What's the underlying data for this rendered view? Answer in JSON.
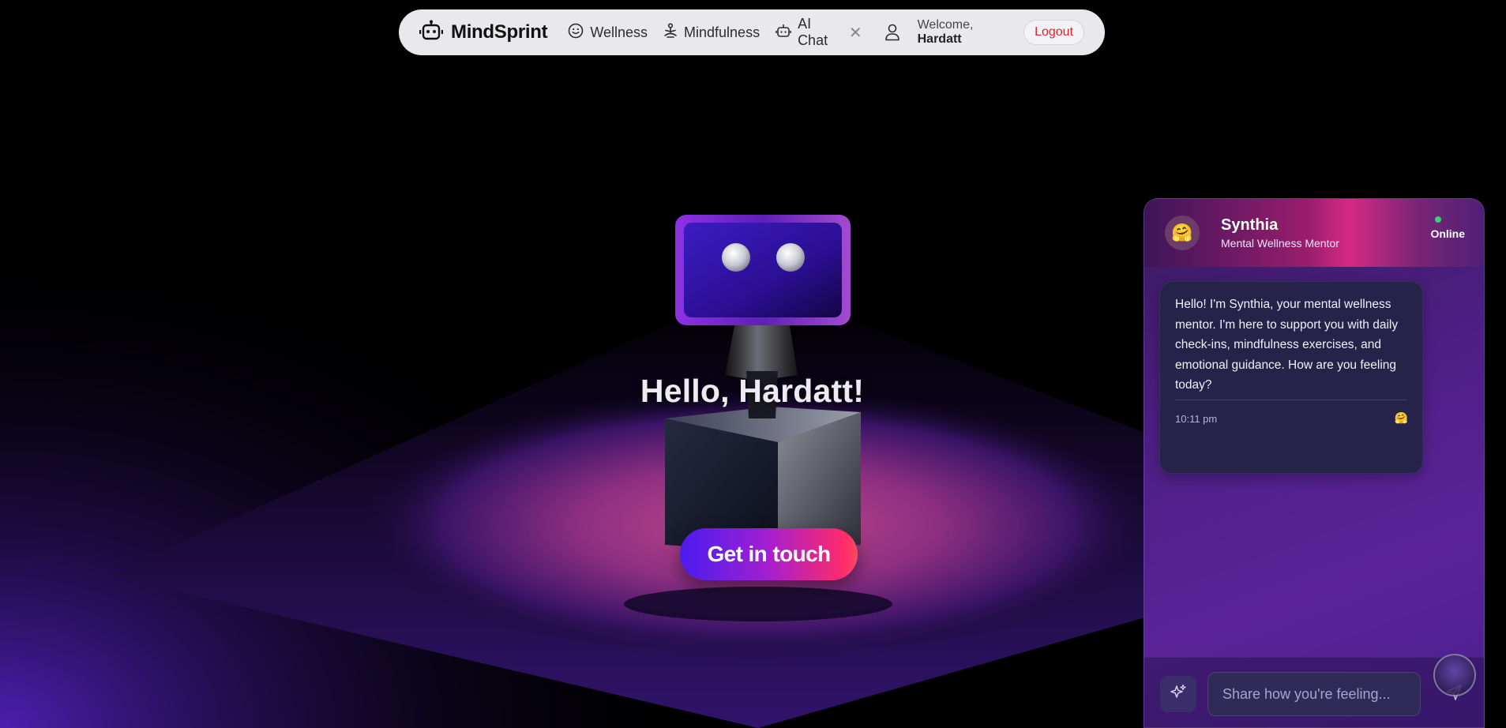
{
  "nav": {
    "brand": "MindSprint",
    "links": [
      {
        "label": "Wellness",
        "icon": "smile-icon"
      },
      {
        "label": "Mindfulness",
        "icon": "meditation-icon"
      },
      {
        "label": "AI Chat",
        "icon": "robot-icon"
      }
    ],
    "welcome_prefix": "Welcome,",
    "username": "Hardatt",
    "logout_label": "Logout"
  },
  "hero": {
    "greeting": "Hello, Hardatt!",
    "cta_label": "Get in touch"
  },
  "chat": {
    "agent_name": "Synthia",
    "agent_role": "Mental Wellness Mentor",
    "agent_avatar": "🤗",
    "status": "Online",
    "message": {
      "text": "Hello! I'm Synthia, your mental wellness mentor. I'm here to support you with daily check-ins, mindfulness exercises, and emotional guidance. How are you feeling today?",
      "time": "10:11 pm",
      "reaction": "🤗"
    },
    "input_placeholder": "Share how you're feeling..."
  },
  "colors": {
    "accent_pink": "#ff2a6b",
    "accent_violet": "#4a1cf0",
    "online_green": "#37d178",
    "logout_red": "#d9262c"
  }
}
